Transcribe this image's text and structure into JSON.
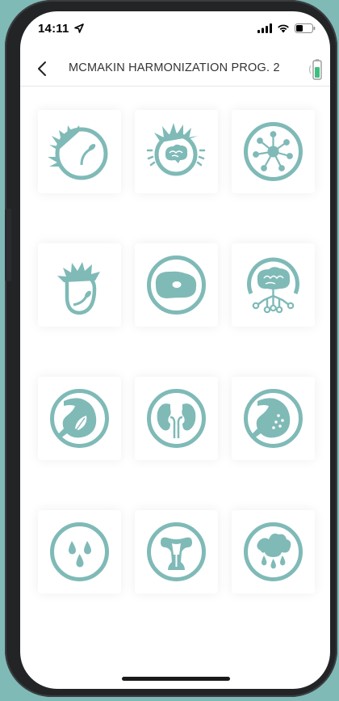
{
  "status": {
    "time": "14:11"
  },
  "nav": {
    "title": "MCMAKIN HARMONIZATION PROG. 2"
  },
  "colors": {
    "accent": "#7fbab7",
    "background": "#ffffff"
  },
  "tiles": [
    {
      "icon": "sperm-cell-icon"
    },
    {
      "icon": "agitated-brain-icon"
    },
    {
      "icon": "nerve-cell-icon"
    },
    {
      "icon": "ovum-sperm-icon"
    },
    {
      "icon": "kidney-bean-icon"
    },
    {
      "icon": "brain-network-icon"
    },
    {
      "icon": "stomach-leaf-icon"
    },
    {
      "icon": "kidneys-icon"
    },
    {
      "icon": "stomach-dots-icon"
    },
    {
      "icon": "drops-icon"
    },
    {
      "icon": "uterus-icon"
    },
    {
      "icon": "nose-drops-icon"
    }
  ]
}
